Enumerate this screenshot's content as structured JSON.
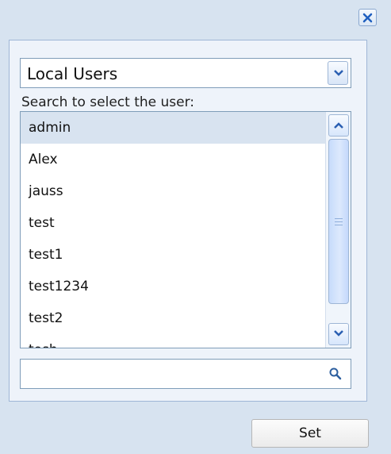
{
  "dialog": {
    "user_source": {
      "selected": "Local Users"
    },
    "search_label": "Search to select the user:",
    "users": [
      "admin",
      "Alex",
      "jauss",
      "test",
      "test1",
      "test1234",
      "test2",
      "tosh"
    ],
    "selected_user": "admin",
    "search": {
      "value": "",
      "placeholder": ""
    },
    "set_button_label": "Set"
  },
  "icons": {
    "close": "close-icon",
    "dropdown": "chevron-down-icon",
    "scroll_up": "chevron-up-icon",
    "scroll_down": "chevron-down-icon",
    "search": "search-icon"
  },
  "colors": {
    "background": "#d7e3f0",
    "panel_background": "#eef3fa",
    "selected_row": "#d8e3f0",
    "accent": "#1f5fbf"
  }
}
